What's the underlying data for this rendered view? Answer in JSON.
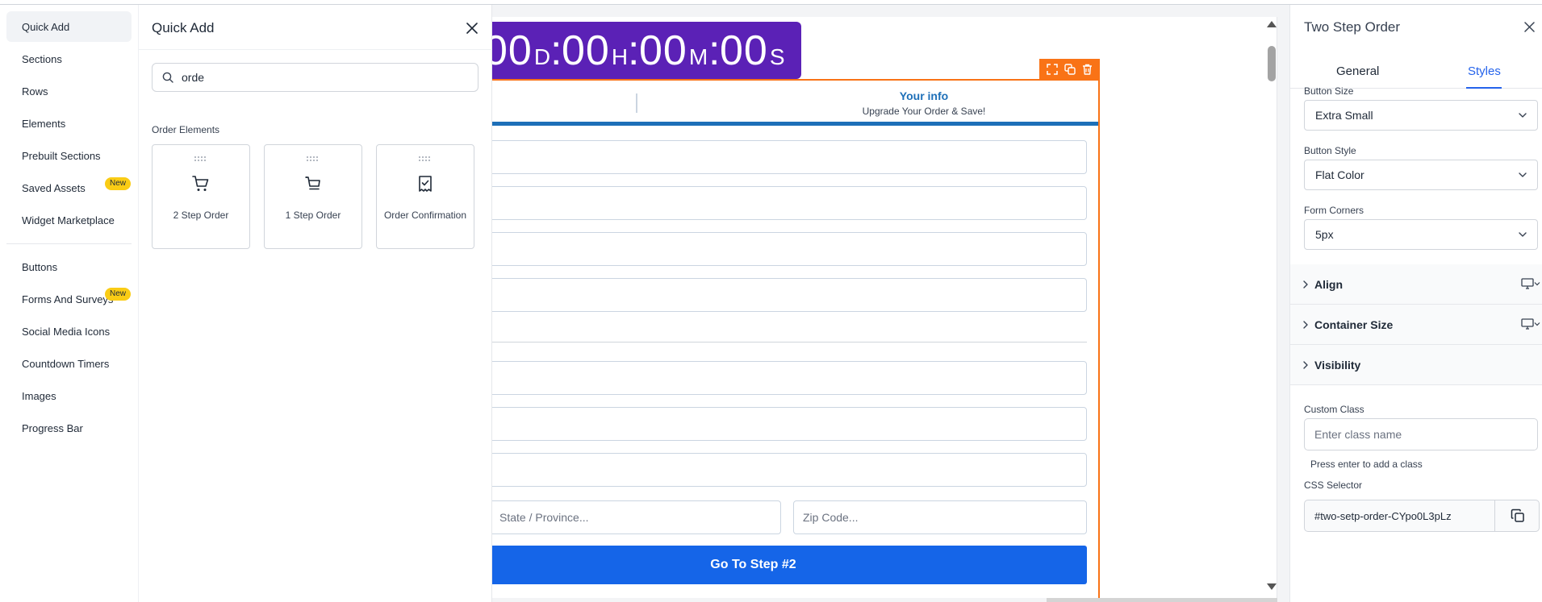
{
  "left_nav": {
    "items": [
      {
        "label": "Quick Add",
        "active": true
      },
      {
        "label": "Sections"
      },
      {
        "label": "Rows"
      },
      {
        "label": "Elements"
      },
      {
        "label": "Prebuilt Sections"
      },
      {
        "label": "Saved Assets",
        "badge": "New"
      },
      {
        "label": "Widget Marketplace"
      },
      {
        "label": "Buttons"
      },
      {
        "label": "Forms And Surveys",
        "badge": "New"
      },
      {
        "label": "Social Media Icons"
      },
      {
        "label": "Countdown Timers"
      },
      {
        "label": "Images"
      },
      {
        "label": "Progress Bar"
      }
    ]
  },
  "quick_add": {
    "title": "Quick Add",
    "search_value": "orde",
    "section_label": "Order Elements",
    "elements": [
      {
        "label": "2 Step Order",
        "icon": "cart-icon"
      },
      {
        "label": "1 Step Order",
        "icon": "cart-icon"
      },
      {
        "label": "Order Confirmation",
        "icon": "receipt-check-icon"
      }
    ]
  },
  "canvas": {
    "timer": {
      "days": "00",
      "days_unit": "D",
      "hours": "00",
      "hours_unit": "H",
      "minutes": "00",
      "minutes_unit": "M",
      "seconds": "00",
      "seconds_unit": "S",
      "colon": ":"
    },
    "tab": {
      "title": "Your info",
      "subtitle": "Upgrade Your Order & Save!"
    },
    "state_placeholder": "State / Province...",
    "zip_placeholder": "Zip Code...",
    "cta_label": "Go To Step #2",
    "colors": {
      "timer_bg": "#5b21b6",
      "selection": "#f97316",
      "cta": "#1565e8",
      "tab_accent": "#1d6fb8"
    }
  },
  "right_panel": {
    "title": "Two Step Order",
    "tabs": {
      "general": "General",
      "styles": "Styles",
      "active": "Styles"
    },
    "button_size_label": "Button Size",
    "button_size_value": "Extra Small",
    "button_style_label": "Button Style",
    "button_style_value": "Flat Color",
    "form_corners_label": "Form Corners",
    "form_corners_value": "5px",
    "accordions": {
      "align": "Align",
      "container_size": "Container Size",
      "visibility": "Visibility"
    },
    "custom_class_label": "Custom Class",
    "custom_class_placeholder": "Enter class name",
    "custom_class_help": "Press enter to add a class",
    "css_selector_label": "CSS Selector",
    "css_selector_value": "#two-setp-order-CYpo0L3pLz"
  }
}
